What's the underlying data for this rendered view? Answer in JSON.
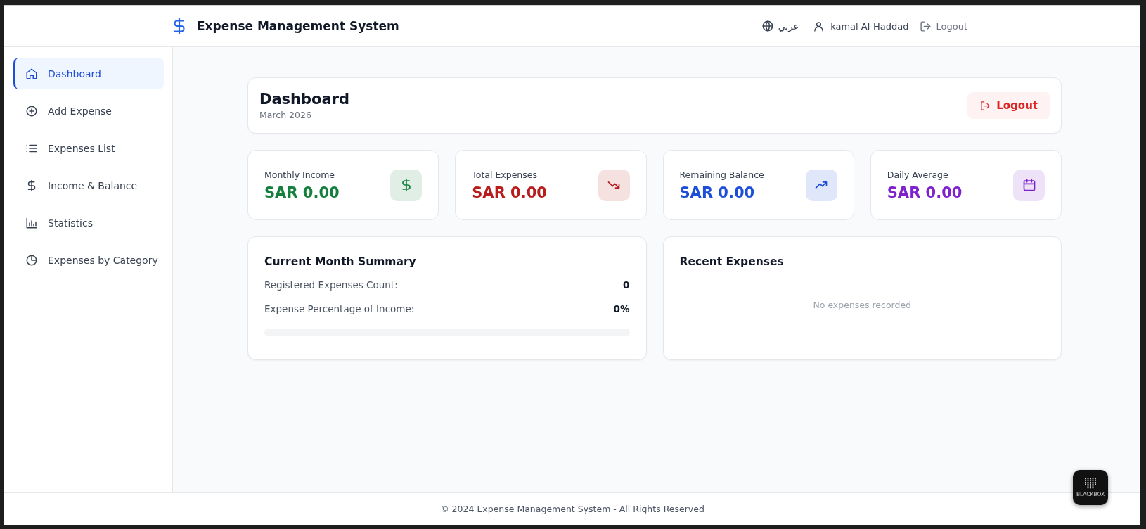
{
  "header": {
    "title": "Expense Management System",
    "language": "عربي",
    "user": "kamal Al-Haddad",
    "logout": "Logout"
  },
  "sidebar": {
    "items": [
      {
        "label": "Dashboard",
        "kind": "home",
        "selected": true
      },
      {
        "label": "Add Expense",
        "kind": "add",
        "selected": false
      },
      {
        "label": "Expenses List",
        "kind": "list",
        "selected": false
      },
      {
        "label": "Income & Balance",
        "kind": "money",
        "selected": false
      },
      {
        "label": "Statistics",
        "kind": "stats",
        "selected": false
      },
      {
        "label": "Expenses by Category",
        "kind": "category",
        "selected": false
      }
    ]
  },
  "page": {
    "title": "Dashboard",
    "subtitle": "March 2026",
    "logout": "Logout"
  },
  "stats": [
    {
      "label": "Monthly Income",
      "value": "SAR 0.00",
      "kind": "income",
      "color": "#15803d"
    },
    {
      "label": "Total Expenses",
      "value": "SAR 0.00",
      "kind": "expenses",
      "color": "#b91c1c"
    },
    {
      "label": "Remaining Balance",
      "value": "SAR 0.00",
      "kind": "balance",
      "color": "#1d4ed8"
    },
    {
      "label": "Daily Average",
      "value": "SAR 0.00",
      "kind": "average",
      "color": "#7e22ce"
    }
  ],
  "summary": {
    "title": "Current Month Summary",
    "rows": [
      {
        "label": "Registered Expenses Count:",
        "value": "0"
      },
      {
        "label": "Expense Percentage of Income:",
        "value": "0%"
      }
    ],
    "level": 0
  },
  "recent": {
    "title": "Recent Expenses",
    "empty": "No expenses recorded"
  },
  "footer": "© 2024 Expense Management System - All Rights Reserved",
  "widget": {
    "label": "BLACKBOX"
  }
}
